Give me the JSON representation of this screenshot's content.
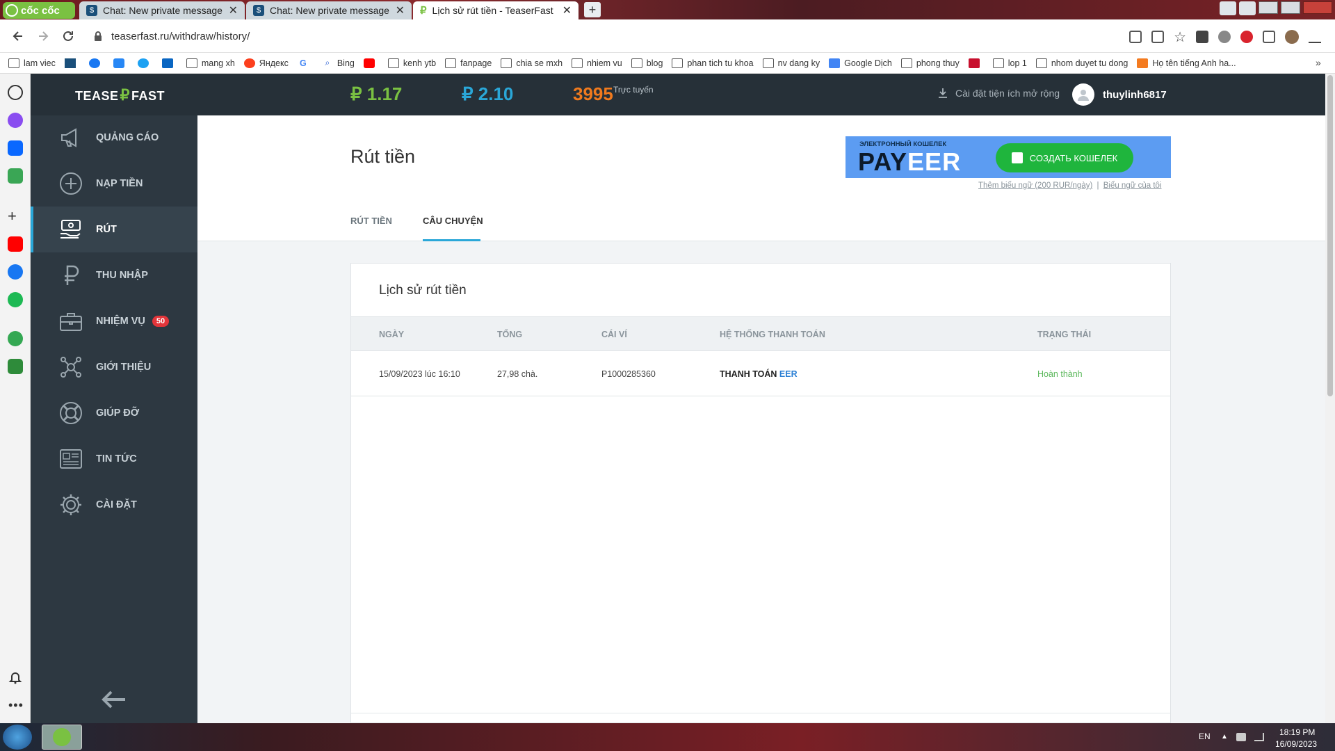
{
  "browser": {
    "brand": "cốc cốc",
    "tabs": [
      {
        "title": "Chat: New private message"
      },
      {
        "title": "Chat: New private message"
      },
      {
        "title": "Lịch sử rút tiền - TeaserFast"
      }
    ],
    "url": "teaserfast.ru/withdraw/history/",
    "bookmarks": [
      "lam viec",
      "",
      "",
      "",
      "",
      "",
      "mang xh",
      "Яндекс",
      "",
      "Bing",
      "",
      "kenh ytb",
      "fanpage",
      "chia se mxh",
      "nhiem vu",
      "blog",
      "phan tich tu khoa",
      "nv dang ky",
      "Google Dịch",
      "phong thuy",
      "",
      "lop 1",
      "nhom duyet tu dong",
      "Họ tên tiếng Anh ha..."
    ]
  },
  "site": {
    "brand_left": "TEASE",
    "brand_right": "FAST",
    "balance1": "₽ 1.17",
    "balance2": "₽ 2.10",
    "online_count": "3995",
    "online_label": "Trực tuyến",
    "install_ext": "Cài đặt tiện ích mở rộng",
    "username": "thuylinh6817",
    "nav": [
      {
        "label": "QUẢNG CÁO",
        "icon": "megaphone-icon"
      },
      {
        "label": "NẠP TIỀN",
        "icon": "plus-circle-icon"
      },
      {
        "label": "RÚT",
        "icon": "cash-hand-icon"
      },
      {
        "label": "THU NHẬP",
        "icon": "ruble-icon"
      },
      {
        "label": "NHIỆM VỤ",
        "icon": "briefcase-icon",
        "badge": "50"
      },
      {
        "label": "GIỚI THIỆU",
        "icon": "network-icon"
      },
      {
        "label": "GIÚP ĐỠ",
        "icon": "lifebuoy-icon"
      },
      {
        "label": "TIN TỨC",
        "icon": "news-icon"
      },
      {
        "label": "CÀI ĐẶT",
        "icon": "gear-icon"
      }
    ],
    "active_nav": 2
  },
  "page": {
    "title": "Rút tiền",
    "tabs": [
      "RÚT TIỀN",
      "CÂU CHUYỆN"
    ],
    "active_tab": 1,
    "banner": {
      "small": "ЭЛЕКТРОННЫЙ КОШЕЛЕК",
      "brand_pay": "PAY",
      "brand_eer": "EER",
      "button": "СОЗДАТЬ КОШЕЛЕК",
      "link1": "Thêm biểu ngữ (200 RUR/ngày)",
      "sep": "|",
      "link2": "Biểu ngữ của tôi"
    },
    "card_title": "Lịch sử rút tiền",
    "columns": [
      "NGÀY",
      "TỔNG",
      "CÁI VÍ",
      "HỆ THỐNG THANH TOÁN",
      "TRẠNG THÁI"
    ],
    "rows": [
      {
        "date": "15/09/2023 lúc 16:10",
        "total": "27,98 chà.",
        "wallet": "P1000285360",
        "system_a": "THANH TOÁN",
        "system_b": "EER",
        "status": "Hoàn thành"
      }
    ]
  },
  "taskbar": {
    "lang": "EN",
    "time": "18:19 PM",
    "date": "16/09/2023"
  },
  "colors": {
    "green": "#7ac142",
    "blue": "#2aa7d8",
    "orange": "#f07a1e",
    "status_green": "#5cb85c"
  }
}
